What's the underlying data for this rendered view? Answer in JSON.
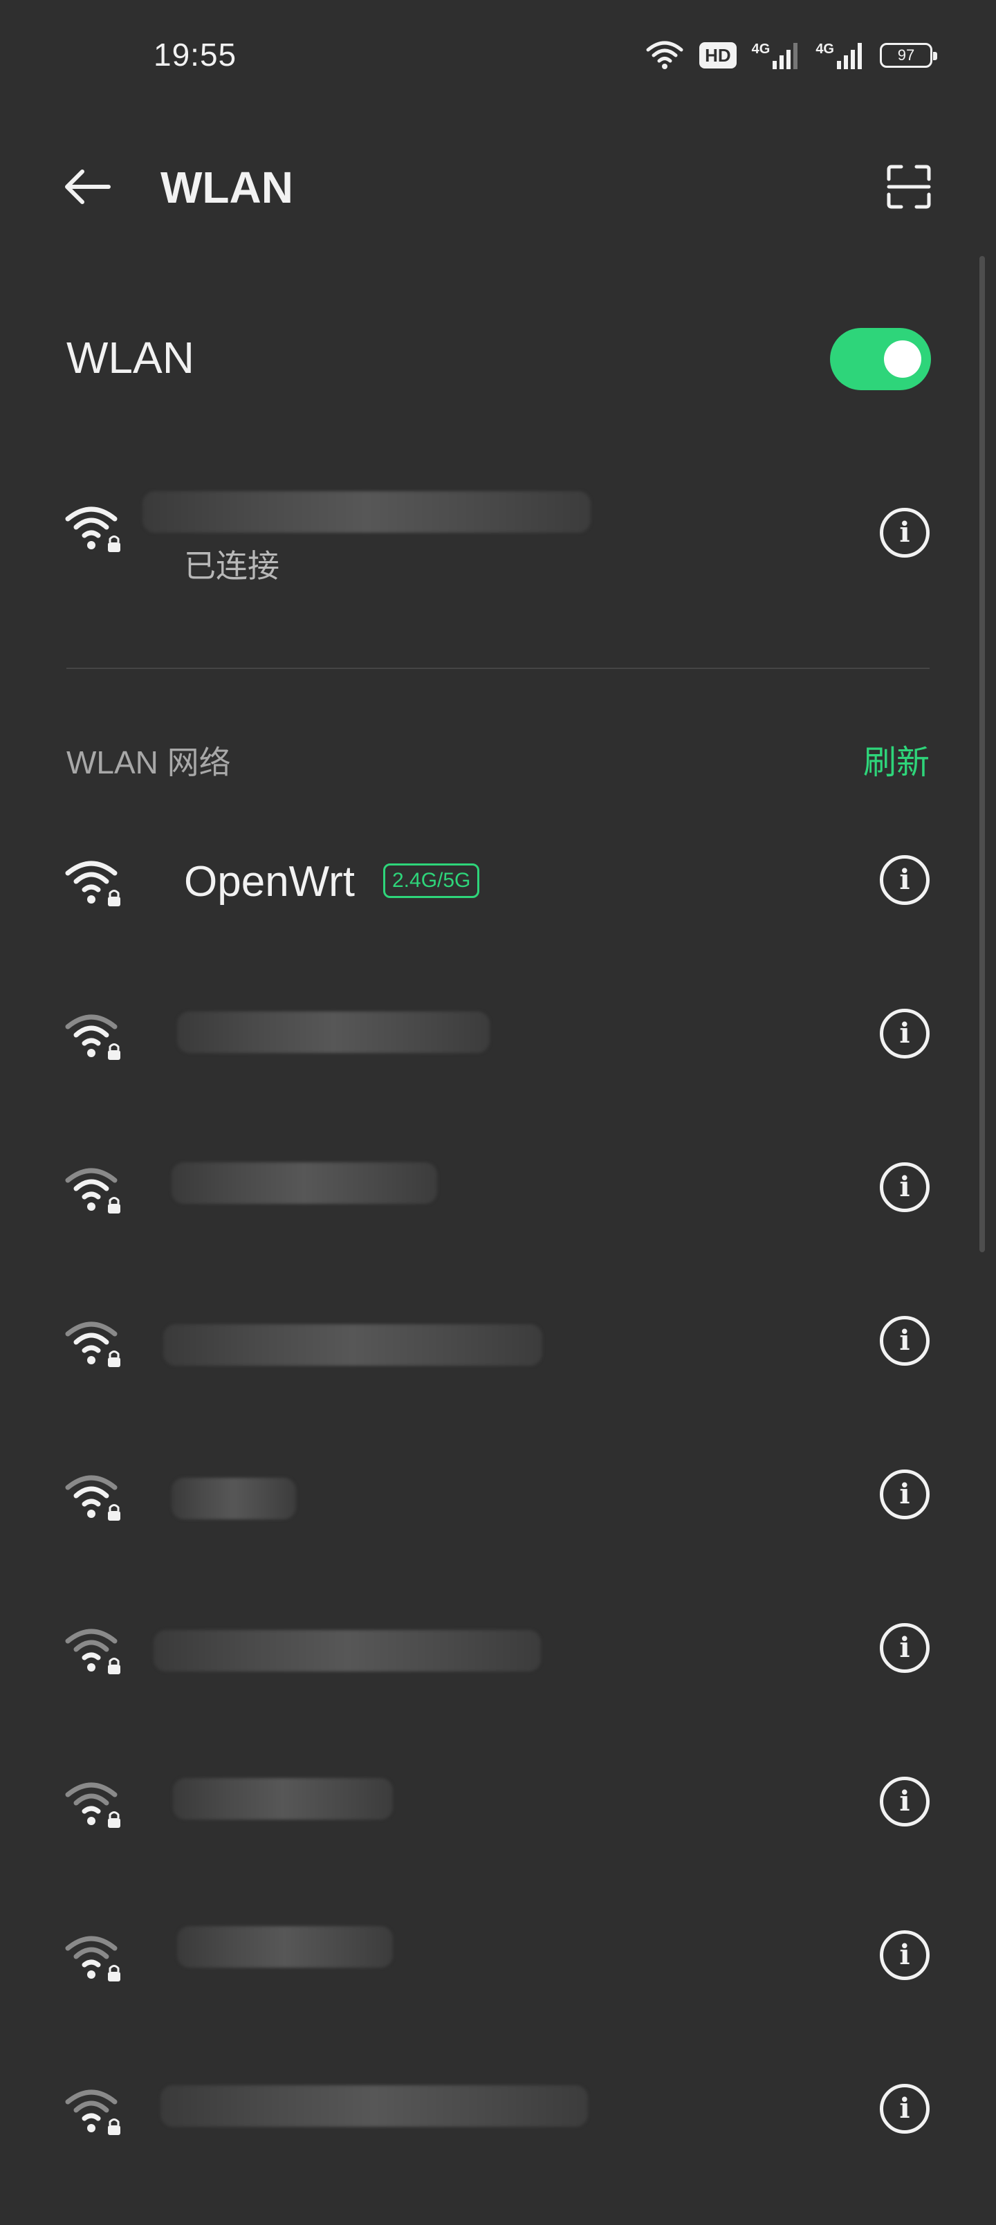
{
  "status_bar": {
    "time": "19:55",
    "hd_label": "HD",
    "net1_label": "4G",
    "net2_label": "4G",
    "battery": "97",
    "icons": [
      "wifi-icon",
      "hd-voice-icon",
      "signal-icon",
      "signal-icon",
      "battery-icon"
    ]
  },
  "header": {
    "title": "WLAN",
    "back_icon": "arrow-left-icon",
    "scan_icon": "scan-icon"
  },
  "wlan_toggle": {
    "label": "WLAN",
    "on": true,
    "color": "#2ed57a"
  },
  "connected": {
    "status": "已连接",
    "icon": "wifi-lock-icon"
  },
  "networks_section": {
    "title": "WLAN 网络",
    "refresh_label": "刷新"
  },
  "networks": [
    {
      "ssid": "OpenWrt",
      "band": "2.4G/5G",
      "secured": true,
      "signal": "strong"
    },
    {
      "ssid": "",
      "secured": true,
      "signal": "medium"
    },
    {
      "ssid": "",
      "secured": true,
      "signal": "medium"
    },
    {
      "ssid": "",
      "secured": true,
      "signal": "medium"
    },
    {
      "ssid": "",
      "secured": true,
      "signal": "medium"
    },
    {
      "ssid": "",
      "secured": true,
      "signal": "weak"
    },
    {
      "ssid": "",
      "secured": true,
      "signal": "weak"
    },
    {
      "ssid": "",
      "secured": true,
      "signal": "weak"
    },
    {
      "ssid": "",
      "secured": true,
      "signal": "weak"
    }
  ],
  "colors": {
    "background": "#2f2f2f",
    "accent": "#2ed57a",
    "text": "#f2f2f2",
    "secondary_text": "#a8a8a8"
  }
}
